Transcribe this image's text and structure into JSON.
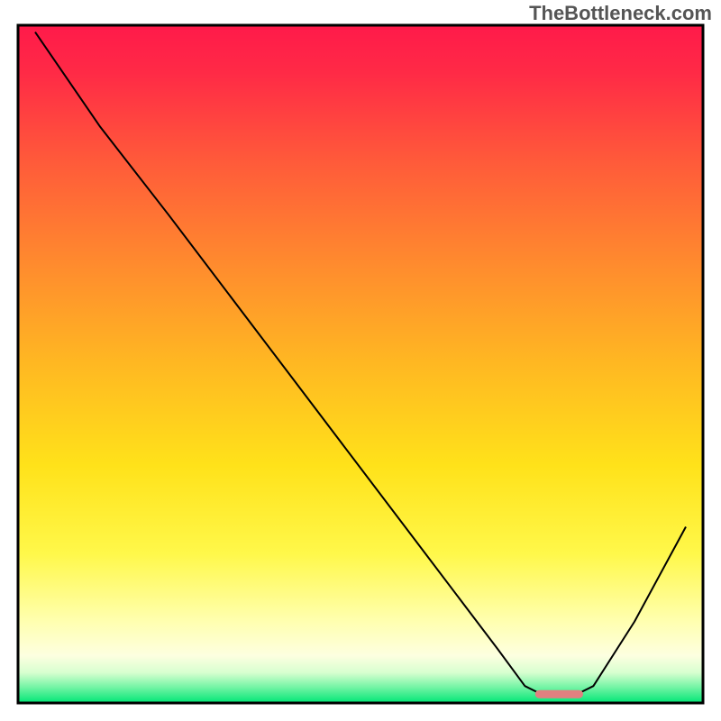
{
  "watermark": "TheBottleneck.com",
  "chart_data": {
    "type": "line",
    "title": "",
    "xlabel": "",
    "ylabel": "",
    "xlim": [
      0,
      100
    ],
    "ylim": [
      0,
      100
    ],
    "background_gradient": {
      "stops": [
        {
          "offset": 0.0,
          "color": "#ff1a4a"
        },
        {
          "offset": 0.07,
          "color": "#ff2a46"
        },
        {
          "offset": 0.2,
          "color": "#ff5a3a"
        },
        {
          "offset": 0.35,
          "color": "#ff8a2e"
        },
        {
          "offset": 0.5,
          "color": "#ffb822"
        },
        {
          "offset": 0.65,
          "color": "#ffe21a"
        },
        {
          "offset": 0.78,
          "color": "#fff84a"
        },
        {
          "offset": 0.88,
          "color": "#ffffb0"
        },
        {
          "offset": 0.93,
          "color": "#fdffe0"
        },
        {
          "offset": 0.955,
          "color": "#d8ffd0"
        },
        {
          "offset": 0.975,
          "color": "#7cf5a8"
        },
        {
          "offset": 1.0,
          "color": "#00e676"
        }
      ]
    },
    "series": [
      {
        "name": "bottleneck-curve",
        "color": "#000000",
        "width": 2,
        "points": [
          {
            "x": 2.5,
            "y": 99.0
          },
          {
            "x": 12.0,
            "y": 85.0
          },
          {
            "x": 22.0,
            "y": 72.0
          },
          {
            "x": 40.0,
            "y": 48.0
          },
          {
            "x": 58.0,
            "y": 24.0
          },
          {
            "x": 70.0,
            "y": 8.0
          },
          {
            "x": 74.0,
            "y": 2.5
          },
          {
            "x": 76.0,
            "y": 1.5
          },
          {
            "x": 82.0,
            "y": 1.5
          },
          {
            "x": 84.0,
            "y": 2.5
          },
          {
            "x": 90.0,
            "y": 12.0
          },
          {
            "x": 97.5,
            "y": 26.0
          }
        ]
      }
    ],
    "marker": {
      "name": "optimal-range",
      "color": "#e08080",
      "x_start": 75.5,
      "x_end": 82.5,
      "y": 1.3,
      "thickness": 1.2
    },
    "plot_frame": {
      "stroke": "#000000",
      "stroke_width": 3
    }
  }
}
